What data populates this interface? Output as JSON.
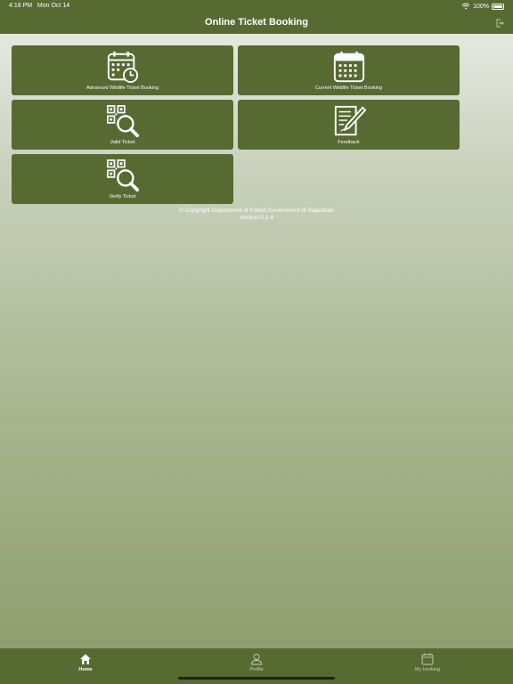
{
  "status": {
    "time": "4:18 PM",
    "date": "Mon Oct 14",
    "battery": "100%"
  },
  "header": {
    "title": "Online Ticket Booking"
  },
  "tiles": [
    {
      "label": "Advanced Wildlife Ticket Booking",
      "icon": "calendar-clock-icon"
    },
    {
      "label": "Current Wildlife Ticket Booking",
      "icon": "calendar-icon"
    },
    {
      "label": "Valid Ticket",
      "icon": "qr-search-icon"
    },
    {
      "label": "Feedback",
      "icon": "document-pencil-icon"
    },
    {
      "label": "Verify Ticket",
      "icon": "qr-search-icon"
    }
  ],
  "footer": {
    "copyright": "© Copyright Department of Forest,Government of Rajasthan",
    "version": "Version:0.1.4"
  },
  "tabbar": {
    "items": [
      {
        "label": "Home",
        "icon": "home-icon",
        "active": true
      },
      {
        "label": "Profile",
        "icon": "person-icon",
        "active": false
      },
      {
        "label": "My booking",
        "icon": "calendar-icon",
        "active": false
      }
    ]
  },
  "colors": {
    "primary": "#566a32"
  }
}
